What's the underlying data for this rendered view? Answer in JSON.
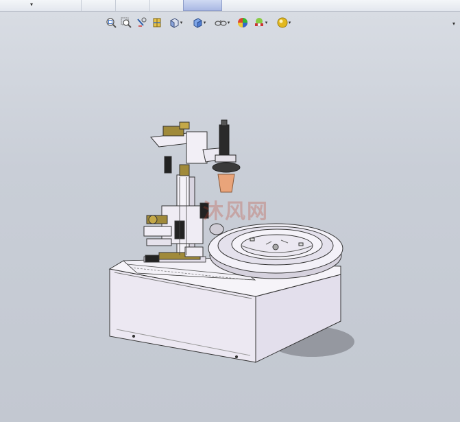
{
  "toolbar": {
    "tools": [
      {
        "icon": "zoom-to-fit-icon"
      },
      {
        "icon": "zoom-to-area-icon"
      },
      {
        "icon": "previous-view-icon"
      },
      {
        "icon": "section-view-icon"
      },
      {
        "icon": "view-orientation-icon"
      },
      {
        "icon": "display-style-icon"
      },
      {
        "icon": "hide-show-items-icon"
      },
      {
        "icon": "edit-appearance-icon"
      },
      {
        "icon": "apply-scene-icon"
      },
      {
        "icon": "view-settings-icon"
      }
    ]
  },
  "watermark": {
    "text": "沐风网"
  },
  "colors": {
    "background": "#c8cdd6",
    "model_body": "#ece8f2",
    "bracket": "#a08a3a",
    "accent_orange": "#e9a47a"
  }
}
